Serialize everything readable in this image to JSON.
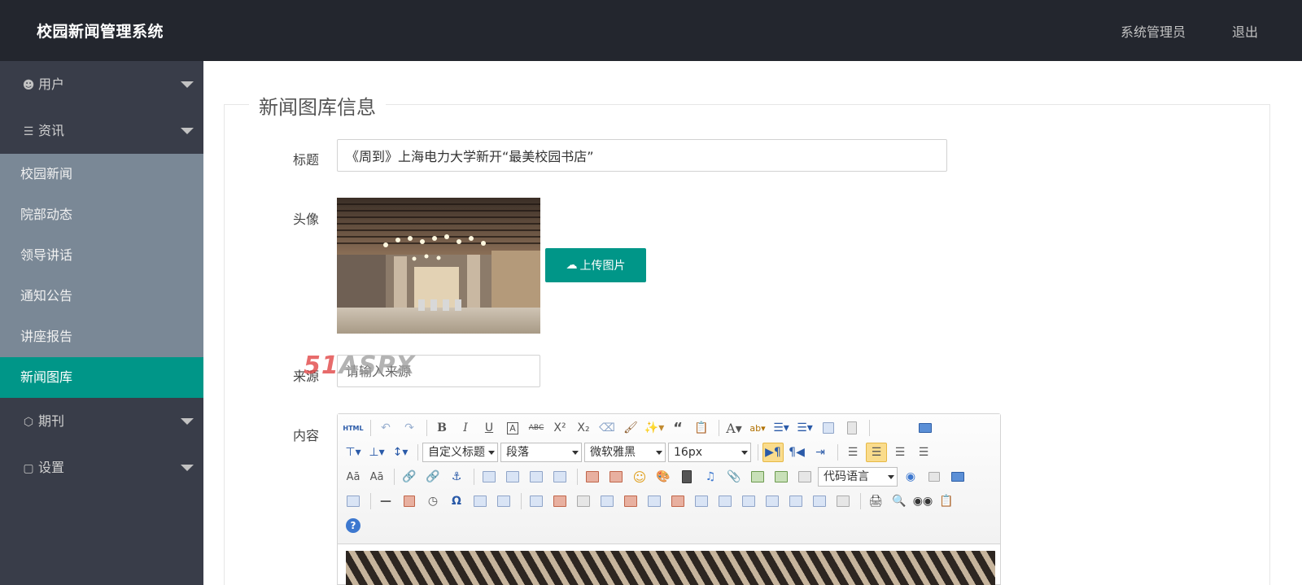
{
  "header": {
    "title": "校园新闻管理系统",
    "user": "系统管理员",
    "logout": "退出"
  },
  "sidebar": {
    "groups": [
      {
        "label": "用户",
        "icon": "user-icon"
      },
      {
        "label": "资讯",
        "icon": "news-icon"
      },
      {
        "label": "期刊",
        "icon": "cube-icon"
      },
      {
        "label": "设置",
        "icon": "file-icon"
      }
    ],
    "subitems": [
      "校园新闻",
      "院部动态",
      "领导讲话",
      "通知公告",
      "讲座报告",
      "新闻图库"
    ],
    "active": "新闻图库"
  },
  "form": {
    "legend": "新闻图库信息",
    "title_label": "标题",
    "title_value": "《周到》上海电力大学新开“最美校园书店”",
    "avatar_label": "头像",
    "upload_label": "上传图片",
    "source_label": "来源",
    "source_placeholder": "请输入来源",
    "content_label": "内容"
  },
  "editor": {
    "html_label": "HTML",
    "selects": {
      "heading": "自定义标题",
      "paragraph": "段落",
      "font": "微软雅黑",
      "size": "16px",
      "code": "代码语言"
    }
  },
  "watermark": {
    "red": "51",
    "gray": "ASPX"
  },
  "colors": {
    "header": "#23262e",
    "sidebar": "#393d49",
    "subnav": "#7a8896",
    "accent": "#009688"
  }
}
